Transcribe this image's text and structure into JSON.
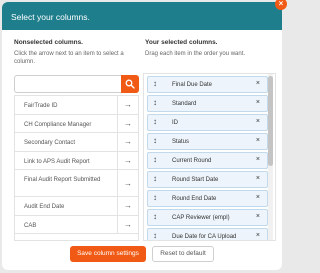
{
  "dialog": {
    "title": "Select your columns."
  },
  "nonselected": {
    "title": "Nonselected columns.",
    "description": "Click the arrow next to an item to select a column.",
    "search_placeholder": "",
    "items": [
      {
        "label": "FairTrade ID",
        "action": "→"
      },
      {
        "label": "CH Compliance Manager",
        "action": "→"
      },
      {
        "label": "Secondary Contact",
        "action": "→"
      },
      {
        "label": "Link to APS Audit Report",
        "action": "→"
      },
      {
        "label": "Final Audit Report Submitted",
        "action": "→"
      },
      {
        "label": "Audit End Date",
        "action": "→"
      },
      {
        "label": "CAB",
        "action": "→"
      }
    ]
  },
  "selected": {
    "title": "Your selected columns.",
    "description": "Drag each item in the order you want.",
    "items": [
      {
        "label": "Final Due Date",
        "grip": "↕",
        "remove": "×"
      },
      {
        "label": "Standard",
        "grip": "↕",
        "remove": "×"
      },
      {
        "label": "ID",
        "grip": "↕",
        "remove": "×"
      },
      {
        "label": "Status",
        "grip": "↕",
        "remove": "×"
      },
      {
        "label": "Current Round",
        "grip": "↕",
        "remove": "×"
      },
      {
        "label": "Round Start Date",
        "grip": "↕",
        "remove": "×"
      },
      {
        "label": "Round End Date",
        "grip": "↕",
        "remove": "×"
      },
      {
        "label": "CAP Reviewer (empl)",
        "grip": "↕",
        "remove": "×"
      },
      {
        "label": "Due Date for CA Upload",
        "grip": "↕",
        "remove": "×"
      }
    ]
  },
  "footer": {
    "save_label": "Save column settings",
    "reset_label": "Reset to default"
  },
  "close_glyph": "×",
  "colors": {
    "header": "#1e7e8c",
    "accent": "#f05a14",
    "selected_item_bg": "#edf4fb"
  }
}
